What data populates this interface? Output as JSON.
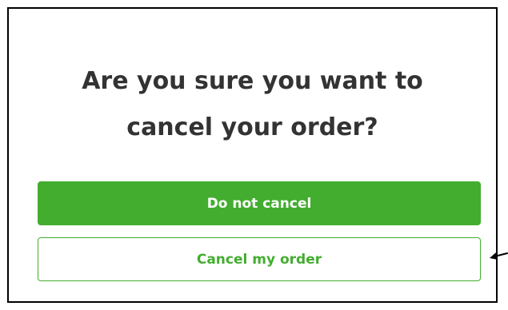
{
  "dialog": {
    "title_line1": "Are you sure you want to",
    "title_line2": "cancel your order?",
    "primary_button_label": "Do not cancel",
    "secondary_button_label": "Cancel my order"
  },
  "colors": {
    "accent": "#43ad2f",
    "title_text": "#333333",
    "border": "#000000"
  },
  "annotation": {
    "icon": "arrow-left-icon"
  }
}
